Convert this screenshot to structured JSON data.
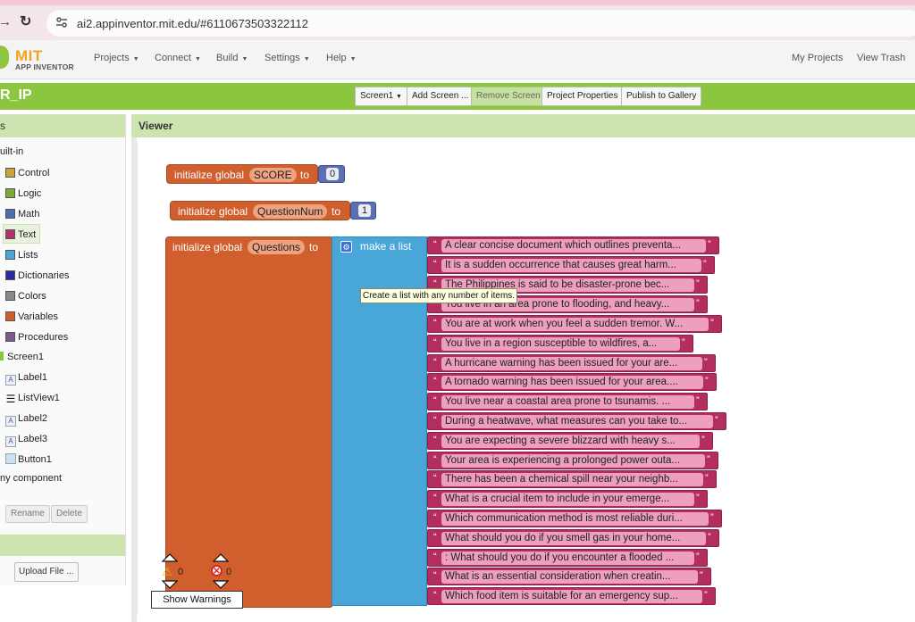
{
  "browser": {
    "url": "ai2.appinventor.mit.edu/#6110673503322112"
  },
  "nav": {
    "logo_title": "MIT",
    "logo_subtitle": "APP INVENTOR",
    "menus": [
      "Projects",
      "Connect",
      "Build",
      "Settings",
      "Help"
    ],
    "my_projects": "My Projects",
    "view_trash": "View Trash"
  },
  "project": {
    "name": "R_IP",
    "screen_select": "Screen1",
    "add_screen": "Add Screen ...",
    "remove_screen": "Remove Screen",
    "project_properties": "Project Properties",
    "publish": "Publish to Gallery"
  },
  "palette": {
    "header": "s",
    "builtin": "uilt-in",
    "categories": [
      {
        "label": "Control",
        "color": "#c8a53a"
      },
      {
        "label": "Logic",
        "color": "#7fa83a"
      },
      {
        "label": "Math",
        "color": "#4a6fb3"
      },
      {
        "label": "Text",
        "color": "#b3306c"
      },
      {
        "label": "Lists",
        "color": "#49a6d9"
      },
      {
        "label": "Dictionaries",
        "color": "#2b2b9e"
      },
      {
        "label": "Colors",
        "color": "#888888"
      },
      {
        "label": "Variables",
        "color": "#d05f2d"
      },
      {
        "label": "Procedures",
        "color": "#7a5a8a"
      }
    ],
    "screen": "Screen1",
    "components": [
      {
        "label": "Label1",
        "icon": "label-icon"
      },
      {
        "label": "ListView1",
        "icon": "listview-icon"
      },
      {
        "label": "Label2",
        "icon": "label-icon"
      },
      {
        "label": "Label3",
        "icon": "label-icon"
      },
      {
        "label": "Button1",
        "icon": "button-icon"
      }
    ],
    "any_component": "ny component",
    "rename": "Rename",
    "delete": "Delete",
    "upload_file": "Upload File ..."
  },
  "viewer": {
    "title": "Viewer",
    "blocks": {
      "init_global": "initialize global",
      "to": "to",
      "score_var": "SCORE",
      "score_val": "0",
      "qnum_var": "QuestionNum",
      "qnum_val": "1",
      "questions_var": "Questions",
      "make_a_list": "make a list",
      "tooltip": "Create a list with any number of items.",
      "strings": [
        "A clear concise document which outlines preventa...",
        "It is a sudden occurrence that causes great harm...",
        "The Philippines is said to be disaster-prone bec...",
        "You live in an area prone to flooding, and heavy...",
        "You are at work when you feel a sudden tremor. W...",
        "You live in a region susceptible to wildfires, a...",
        "A hurricane warning has been issued for your are...",
        "A tornado warning has been issued for your area....",
        "You live near a coastal area prone to tsunamis. ...",
        "During a heatwave, what measures can you take to...",
        "You are expecting a severe blizzard with heavy s...",
        "Your area is experiencing a prolonged power outa...",
        "There has been a chemical spill near your neighb...",
        "What is a crucial item to include in your emerge...",
        "Which communication method is most reliable duri...",
        "What should you do if you smell gas in your home...",
        ": What should you do if you encounter a flooded ...",
        " What is an essential consideration when creatin...",
        "Which food item is suitable for an emergency sup..."
      ]
    },
    "warnings_count": "0",
    "errors_count": "0",
    "show_warnings": "Show Warnings"
  }
}
